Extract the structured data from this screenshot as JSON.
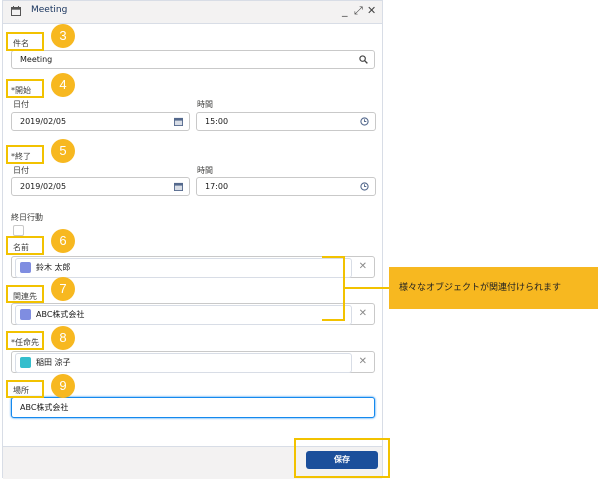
{
  "window": {
    "title": "Meeting",
    "minimize": "_",
    "expand": "⤢",
    "close": "✕"
  },
  "fields": {
    "subject": {
      "label": "件名",
      "value": "Meeting"
    },
    "start": {
      "section": "*開始",
      "date_label": "日付",
      "date_value": "2019/02/05",
      "time_label": "時間",
      "time_value": "15:00"
    },
    "end": {
      "section": "*終了",
      "date_label": "日付",
      "date_value": "2019/02/05",
      "time_label": "時間",
      "time_value": "17:00"
    },
    "all_day": {
      "label": "終日行動"
    },
    "name": {
      "label": "名前",
      "value": "鈴木 太郎",
      "icon_color": "#7f8de1"
    },
    "related_to": {
      "label": "関連先",
      "value": "ABC株式会社",
      "icon_color": "#7f8de1"
    },
    "assigned_to": {
      "label": "*任命先",
      "value": "稲田 涼子",
      "icon_color": "#34becd"
    },
    "location": {
      "label": "場所",
      "value": "ABC株式会社"
    }
  },
  "footer": {
    "save_label": "保存"
  },
  "annotations": {
    "badges": [
      "3",
      "4",
      "5",
      "6",
      "7",
      "8",
      "9"
    ],
    "note": "様々なオブジェクトが関連付けられます",
    "highlight_color": "#f2c200",
    "badge_color": "#f7b820"
  }
}
